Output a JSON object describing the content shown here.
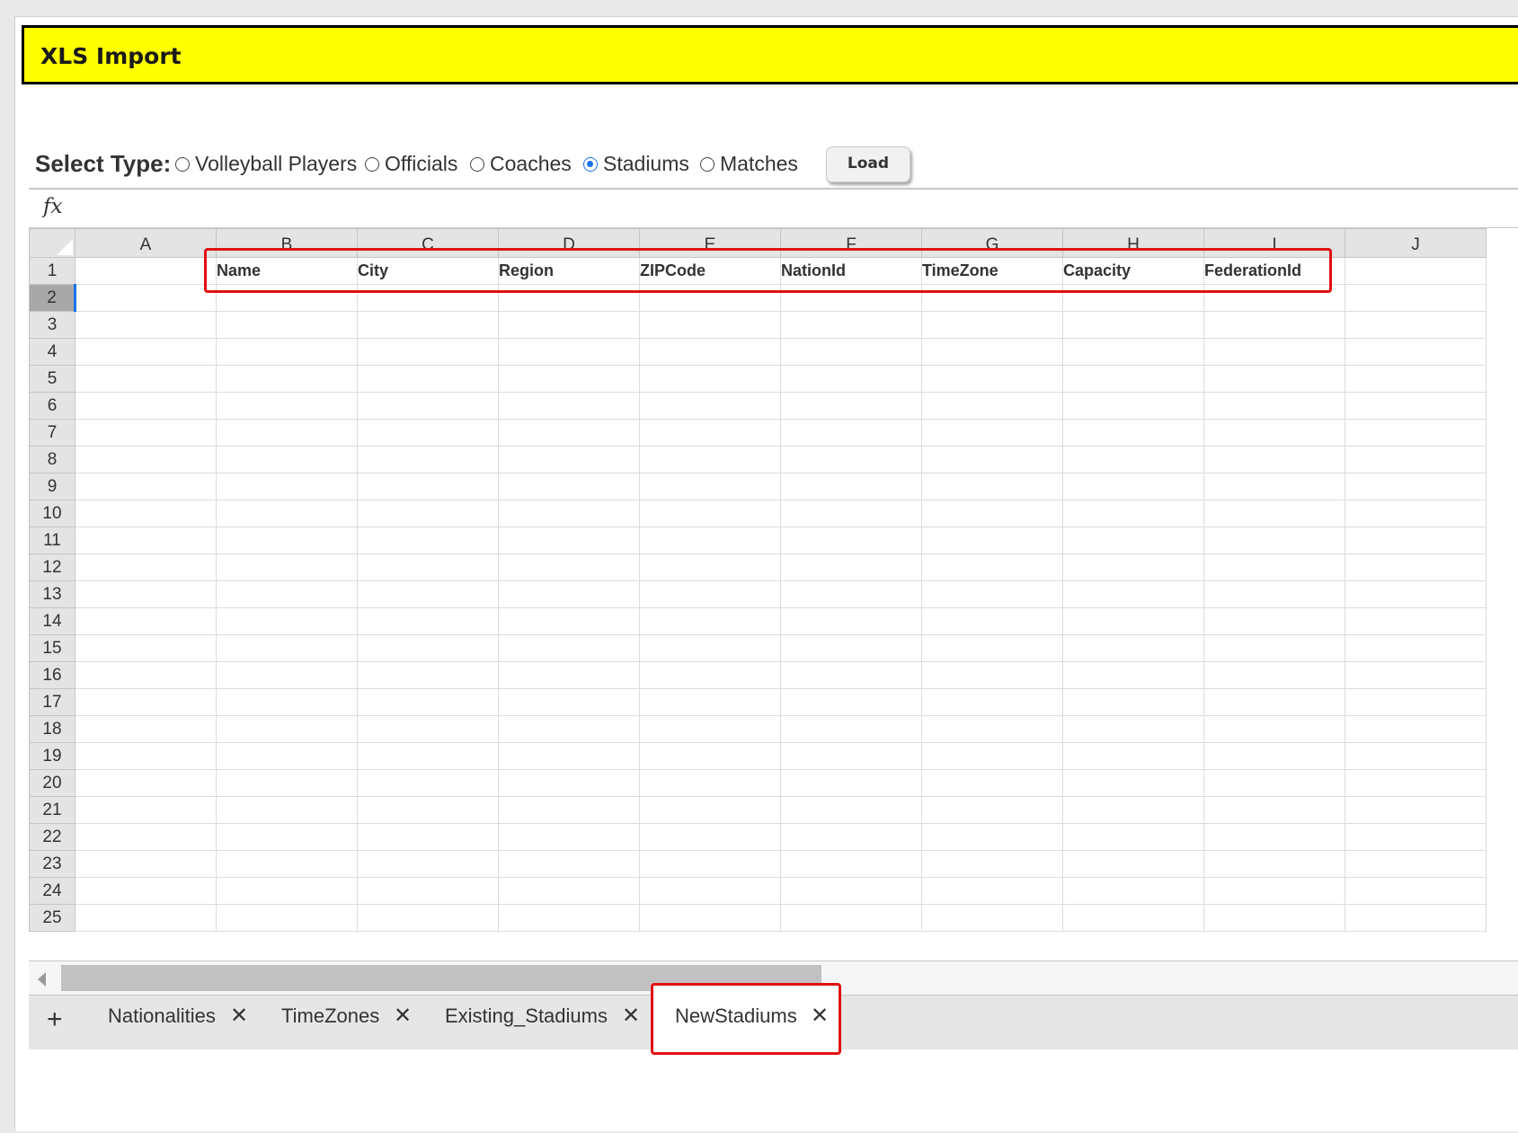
{
  "header": {
    "title": "XLS Import"
  },
  "select_type": {
    "label": "Select Type:",
    "options": [
      {
        "label": "Volleyball Players",
        "checked": false
      },
      {
        "label": "Officials",
        "checked": false
      },
      {
        "label": "Coaches",
        "checked": false
      },
      {
        "label": "Stadiums",
        "checked": true
      },
      {
        "label": "Matches",
        "checked": false
      }
    ],
    "load_label": "Load"
  },
  "formula_bar": {
    "icon": "fx"
  },
  "sheet": {
    "columns": [
      "A",
      "B",
      "C",
      "D",
      "E",
      "F",
      "G",
      "H",
      "I",
      "J"
    ],
    "rows": [
      "1",
      "2",
      "3",
      "4",
      "5",
      "6",
      "7",
      "8",
      "9",
      "10",
      "11",
      "12",
      "13",
      "14",
      "15",
      "16",
      "17",
      "18",
      "19",
      "20",
      "21",
      "22",
      "23",
      "24",
      "25"
    ],
    "selected_row": "2",
    "row1_values": [
      "",
      "Name",
      "City",
      "Region",
      "ZIPCode",
      "NationId",
      "TimeZone",
      "Capacity",
      "FederationId",
      ""
    ]
  },
  "tabs": {
    "add_icon": "+",
    "items": [
      {
        "label": "Nationalities",
        "close": "✕"
      },
      {
        "label": "TimeZones",
        "close": "✕"
      },
      {
        "label": "Existing_Stadiums",
        "close": "✕"
      },
      {
        "label": "NewStadiums",
        "close": "✕",
        "active": true
      }
    ]
  },
  "colors": {
    "title_bg": "#ffff00",
    "highlight": "#e01010",
    "radio_accent": "#1a73e8"
  }
}
